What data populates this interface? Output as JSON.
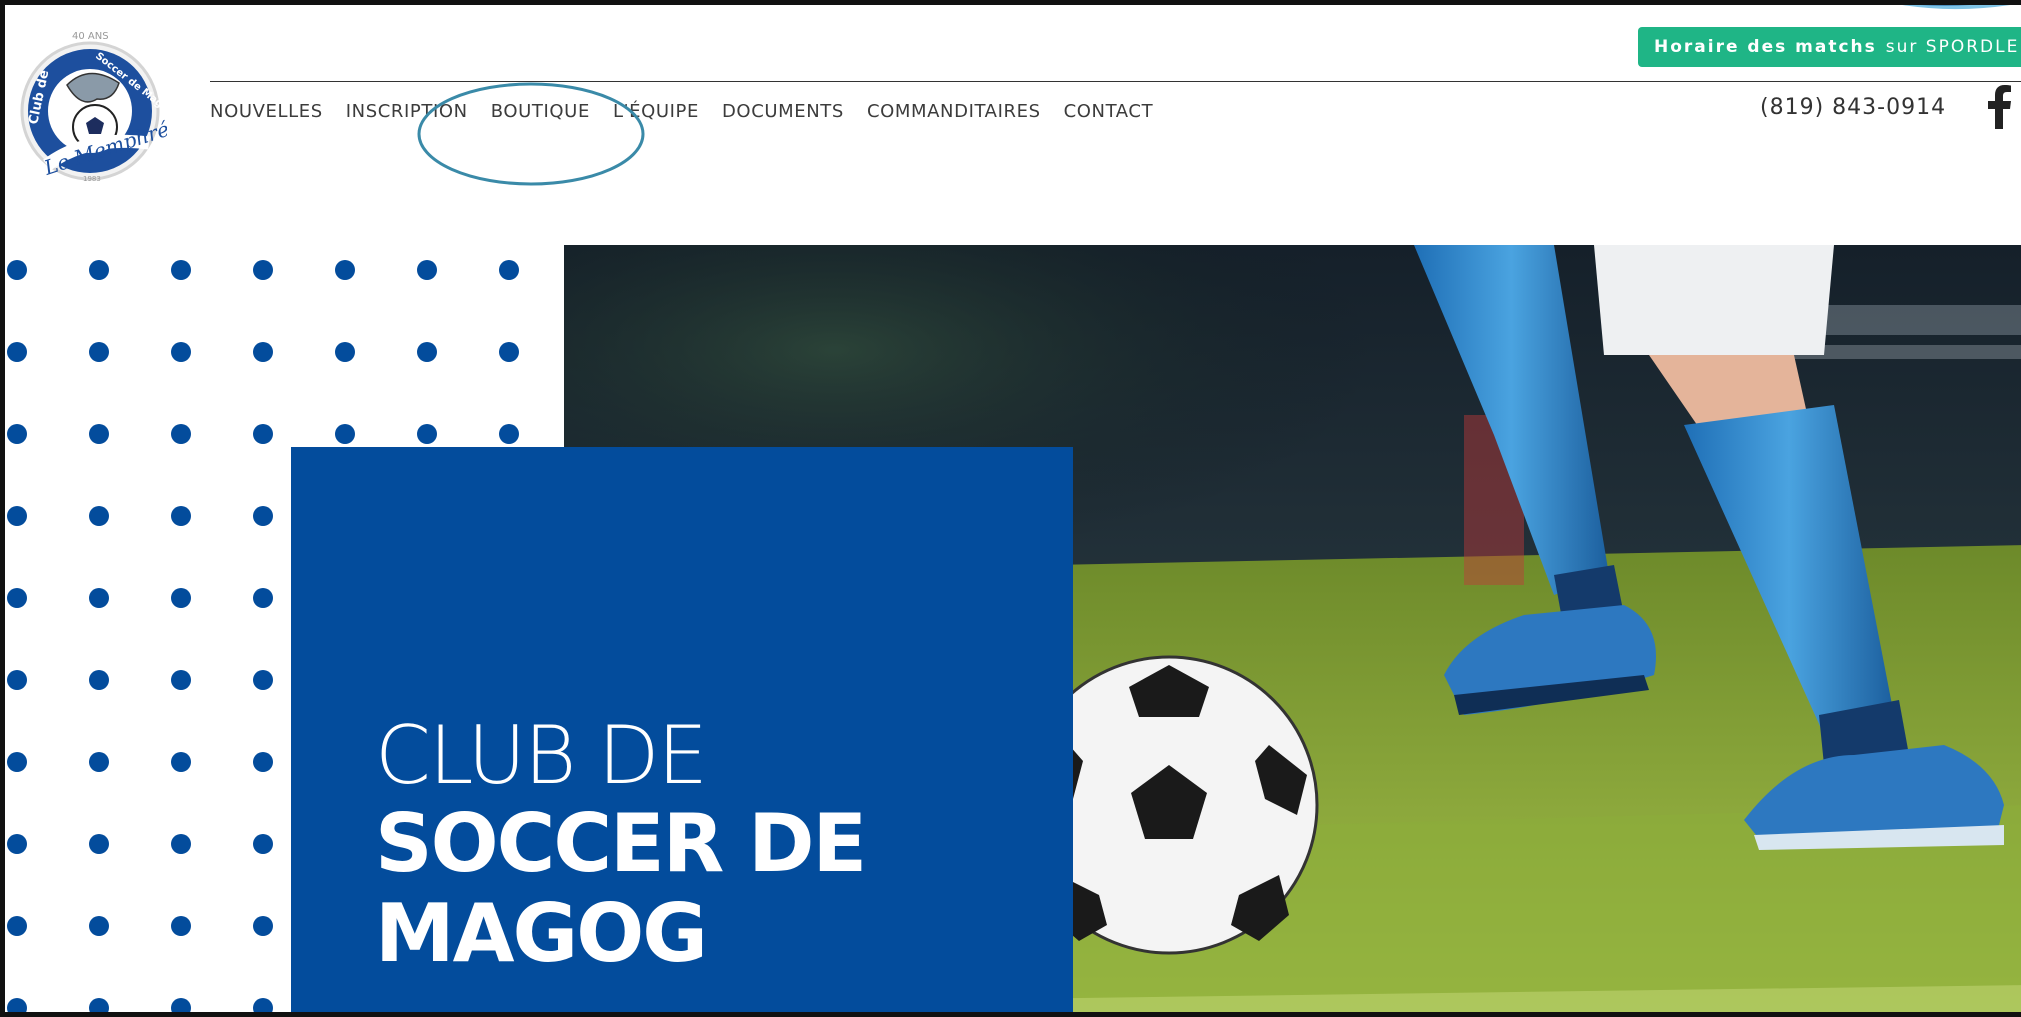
{
  "brand": {
    "logo_top_text": "40 ANS",
    "logo_ring_left": "Club de",
    "logo_ring_right": "Soccer de Magog",
    "logo_script": "Le Memphré",
    "logo_year": "1983"
  },
  "nav": {
    "items": [
      "NOUVELLES",
      "INSCRIPTION",
      "BOUTIQUE",
      "L'ÉQUIPE",
      "DOCUMENTS",
      "COMMANDITAIRES",
      "CONTACT"
    ]
  },
  "header": {
    "spordle_bold": "Horaire des matchs",
    "spordle_rest": "sur SPORDLE",
    "phone": "(819) 843-0914",
    "social_icon": "facebook-icon"
  },
  "hero": {
    "line1": "CLUB DE",
    "line2": "SOCCER DE",
    "line3": "MAGOG"
  },
  "colors": {
    "brand_blue": "#034c9c",
    "spordle_green": "#1fb586",
    "annotation_teal": "#3a8aa8"
  }
}
